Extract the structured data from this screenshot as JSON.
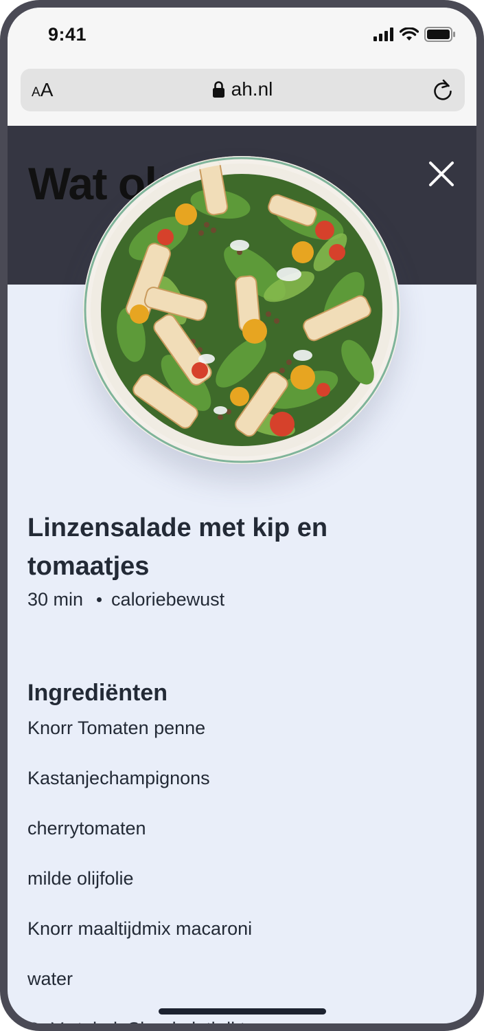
{
  "status_bar": {
    "time": "9:41"
  },
  "browser": {
    "aa_small": "A",
    "aa_large": "A",
    "url": "ah.nl"
  },
  "header": {
    "title": "Wat ok we van"
  },
  "recipe": {
    "title": "Linzensalade met kip en tomaatjes",
    "duration": "30 min",
    "tag": "caloriebewust"
  },
  "ingredients": {
    "heading": "Ingrediënten",
    "items": [
      "Knorr Tomaten penne",
      "Kastanjechampignons",
      "cherrytomaten",
      "milde olijfolie",
      "Knorr maaltijdmix macaroni",
      "water",
      "D. V. .t. h. l. Sh. .d. .l. th.ll.t."
    ]
  },
  "colors": {
    "header_bg": "#353642",
    "content_bg": "#e9eef9",
    "text": "#232a36",
    "frame": "#4a4a55"
  },
  "icons": [
    "signal-icon",
    "wifi-icon",
    "battery-icon",
    "lock-icon",
    "reload-icon",
    "close-icon"
  ]
}
